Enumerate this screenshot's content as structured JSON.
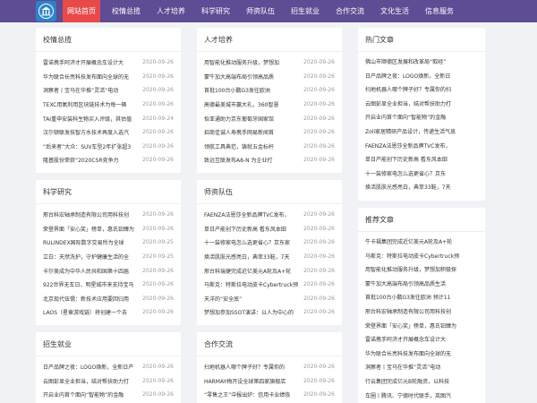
{
  "nav": {
    "items": [
      "网站首页",
      "校情总揽",
      "人才培养",
      "科学研究",
      "师资队伍",
      "招生就业",
      "合作交流",
      "文化生活",
      "信息服务"
    ],
    "active_color": "#e84a4a",
    "bar_color": "#5e4c94"
  },
  "cards": {
    "xqzl": {
      "title": "校情总揽",
      "items": [
        {
          "t": "雷诺携手阿济才开展概念车设计大",
          "d": "2020-09-26"
        },
        {
          "t": "华为联合长亮科技发布面向全球的无",
          "d": "2020-09-26"
        },
        {
          "t": "洞察者丨宝马在华推“灵活”电动",
          "d": "2020-09-26"
        },
        {
          "t": "TEXC用氧利用区块链技术为每一辆",
          "d": "2020-09-26"
        },
        {
          "t": "TAI重申安装科生物买入评级，其估值",
          "d": "2020-09-24"
        },
        {
          "t": "汉尔顿联发技智方水技术再度入选汽",
          "d": "2020-09-26"
        },
        {
          "t": "“后来者”大众：SUV车型2年扩张超3",
          "d": "2020-09-26"
        },
        {
          "t": "隆基股份荣获“2020CSR竞争力",
          "d": "2020-09-26"
        }
      ]
    },
    "rcpy": {
      "title": "人才培养",
      "items": [
        {
          "t": "用智能化推动服务升级，梦想加",
          "d": "2020-09-26"
        },
        {
          "t": "蒙牛加大高端布局引领高品质",
          "d": "2020-09-26"
        },
        {
          "t": "首批100台小鹏G3发往欧洲",
          "d": "2020-09-26"
        },
        {
          "t": "高德最美城市赢大礼，360智慧",
          "d": "2020-09-26"
        },
        {
          "t": "怡亚通助力京东葡萄牙国家馆",
          "d": "2020-09-26"
        },
        {
          "t": "招商佳诚人寿携手网易新闻首",
          "d": "2020-09-26"
        },
        {
          "t": "领航工具典范，铸就五金标杆",
          "d": "2020-09-26"
        },
        {
          "t": "致远互联发布A8-N 为企业打",
          "d": "2020-09-26"
        }
      ]
    },
    "kxyj": {
      "title": "科学研究",
      "items": [
        {
          "t": "邢台科宏轴承制造有限公司用科技创",
          "d": "2020-09-26"
        },
        {
          "t": "荣登界面「安心奖」榜单，惠氏铂臻为",
          "d": "2020-09-26"
        },
        {
          "t": "RULINDEX国际数字交易所为全球",
          "d": "2020-09-25"
        },
        {
          "t": "立白：天然洗护，守护健康生活的全",
          "d": "2020-09-25"
        },
        {
          "t": "卡尔美成为中华人民共和国第十四届",
          "d": "2020-09-26"
        },
        {
          "t": "922世界无车日，明星城市来支持宝马",
          "d": "2020-09-26"
        },
        {
          "t": "北京现代伍锡：新技术应用要回归用",
          "d": "2020-09-26"
        },
        {
          "t": "LAOS（星章游戏链）将创建一个去",
          "d": "2020-09-26"
        }
      ]
    },
    "szdw": {
      "title": "师资队伍",
      "items": [
        {
          "t": "FAENZA法恩莎全新品牌TVC发布，",
          "d": "2020-09-26"
        },
        {
          "t": "单日产能创下历史新高 看东风本田",
          "d": "2020-09-26"
        },
        {
          "t": "十一装修家电怎么选更省心？京东家",
          "d": "2020-09-26"
        },
        {
          "t": "焕活肌肤光感亮白，典萃33鞋，7天",
          "d": "2020-09-26"
        },
        {
          "t": "邢台科瑞捷完成近亿美元A轮及A+轮",
          "d": "2020-09-26"
        },
        {
          "t": "马斯克：特斯拉电动皮卡Cybertruck预",
          "d": "2020-09-26"
        },
        {
          "t": "天洋的“安全底”",
          "d": "2020-09-26"
        },
        {
          "t": "梦想加参加SSOT演讲：以人为中心的",
          "d": "2020-09-26"
        }
      ]
    },
    "zsjy": {
      "title": "招生就业",
      "items": [
        {
          "t": "日产品牌之夜：LOGO焕新，全新日产",
          "d": "2020-09-26"
        },
        {
          "t": "云图彭显全业担当，结对帮扶助力打",
          "d": "2020-09-26"
        },
        {
          "t": "开启业内首个面向“智能物”的金融",
          "d": "2020-09-26"
        }
      ]
    },
    "hzjl": {
      "title": "合作交流",
      "items": [
        {
          "t": "扫地机器人哪个牌子好？专属你的",
          "d": "2020-09-26"
        },
        {
          "t": "HARMAY梅开设全球第四家旗舰店",
          "d": "2020-09-26"
        },
        {
          "t": "“零售之王”中报出炉：信用卡业绩恢",
          "d": "2020-09-26"
        }
      ]
    }
  },
  "sidebar": {
    "hot": {
      "title": "热门文章",
      "items": [
        "佛山市顺德区发展和改革局“取经”",
        "日产品牌之夜：LOGO焕新，全新日",
        "扫地机器人哪个牌子好？专属你的扫",
        "云图彭显全业担当，结对帮扶助力打",
        "开启业内首个面向“智能物”的金融",
        "Zoli家居精研产品设计，传递生活气息",
        "FAENZA法恩莎全新品牌TVC发布，",
        "单日产能创下历史新高 看东风本田",
        "十一装修家电怎么选更省心？京东",
        "焕活肌肤光感亮白，典萃33鞋，7天"
      ]
    },
    "rec": {
      "title": "推荐文章",
      "items": [
        "牛卡福集团完成近亿美元A轮及A+轮",
        "马斯克：特斯拉电动皮卡Cybertruck预",
        "用智能化推动服务升级，梦想加积极探",
        "蒙牛加大高端布局引领高品质生活",
        "首批100台小鹏G3发往欧洲 预计11",
        "邢台科宏轴承制造有限公司用科技创",
        "荣登界面「安心奖」榜单，惠氏铂臻为",
        "雷诺携手阿济才开展概念车设计大",
        "华为联合长亮科技发布面向全球的无",
        "洞察者丨宝马在华推“灵活”电动",
        "行云集团完成亿元B轮融资，以科技",
        "车圈丨腾讯、宁德时代联手，岚图汽"
      ]
    }
  }
}
